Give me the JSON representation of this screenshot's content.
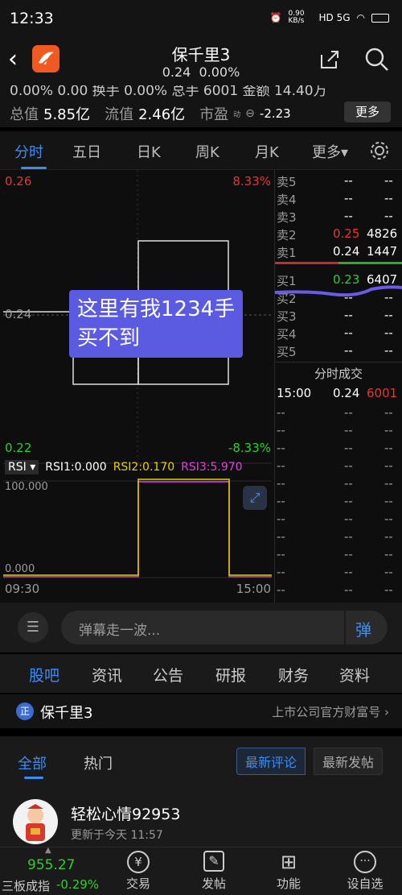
{
  "status": {
    "time": "12:33",
    "net": "0.90 KB/s",
    "icons": "HD 5G"
  },
  "header": {
    "name": "保千里3",
    "price": "0.24",
    "change": "0.00%"
  },
  "summary": {
    "top_text": "0.00%  0.00  换手  0.00%  总手  6001  金额 14.40万",
    "total_value_label": "总值",
    "total_value": "5.85亿",
    "float_value_label": "流值",
    "float_value": "2.46亿",
    "pe_label": "市盈",
    "pe_sup": "动",
    "pe_value": "-2.23",
    "more": "更多"
  },
  "tabs": [
    "分时",
    "五日",
    "日K",
    "周K",
    "月K",
    "更多▾"
  ],
  "chart": {
    "top_price": "0.26",
    "top_pct": "8.33%",
    "mid_price": "0.24",
    "bottom_price": "0.22",
    "bottom_pct": "-8.33%",
    "rsi_label": "RSI ▾",
    "rsi1": "RSI1:0.000",
    "rsi2": "RSI2:0.170",
    "rsi3": "RSI3:5.970",
    "rsi_top": "100.000",
    "rsi_bottom": "0.000",
    "time_start": "09:30",
    "time_end": "15:00",
    "overlay_line1": "这里有我1234手",
    "overlay_line2": "买不到"
  },
  "orderbook": {
    "sell": [
      {
        "label": "卖5",
        "price": "--",
        "vol": "--"
      },
      {
        "label": "卖4",
        "price": "--",
        "vol": "--"
      },
      {
        "label": "卖3",
        "price": "--",
        "vol": "--"
      },
      {
        "label": "卖2",
        "price": "0.25",
        "vol": "4826"
      },
      {
        "label": "卖1",
        "price": "0.24",
        "vol": "1447"
      }
    ],
    "buy": [
      {
        "label": "买1",
        "price": "0.23",
        "vol": "6407"
      },
      {
        "label": "买2",
        "price": "--",
        "vol": "--"
      },
      {
        "label": "买3",
        "price": "--",
        "vol": "--"
      },
      {
        "label": "买4",
        "price": "--",
        "vol": "--"
      },
      {
        "label": "买5",
        "price": "--",
        "vol": "--"
      }
    ],
    "ticks_title": "分时成交",
    "tick": {
      "time": "15:00",
      "price": "0.24",
      "vol": "6001"
    },
    "empty": "--"
  },
  "comment": {
    "placeholder": "弹幕走一波...",
    "danmu": "弹"
  },
  "bottom_tabs": [
    "股吧",
    "资讯",
    "公告",
    "研报",
    "财务",
    "资料"
  ],
  "stockline": {
    "badge": "正",
    "name": "保千里3",
    "right": "上市公司官方财富号 ›"
  },
  "subtabs": {
    "all": "全部",
    "hot": "热门",
    "latest_comment": "最新评论",
    "latest_post": "最新发帖"
  },
  "post": {
    "user": "轻松心情92953",
    "updated": "更新于今天 11:57"
  },
  "nav": {
    "index_value": "955.27",
    "index_name": "三板成指",
    "index_change": "-0.29%",
    "trade": "交易",
    "post": "发帖",
    "features": "功能",
    "watchlist": "设自选"
  },
  "colors": {
    "red": "#e8352f",
    "green": "#2bd02b",
    "blue": "#3c8cf5",
    "yellow": "#e6d000",
    "magenta": "#e040e0",
    "overlay": "#5a5be0"
  }
}
